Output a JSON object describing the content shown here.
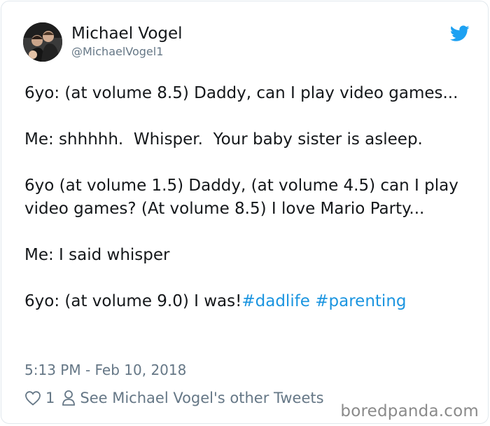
{
  "author": {
    "name": "Michael Vogel",
    "handle": "@MichaelVogel1"
  },
  "tweet": {
    "paragraphs": [
      "6yo: (at volume 8.5) Daddy, can I play video games...",
      "Me: shhhhh.  Whisper.  Your baby sister is asleep.",
      "6yo (at volume 1.5) Daddy, (at volume 4.5) can I play video games? (At volume 8.5) I love Mario Party...",
      "Me: I said whisper"
    ],
    "last_line": "6yo: (at volume 9.0) I was!",
    "hashtags": [
      "#dadlife",
      "#parenting"
    ],
    "timestamp": "5:13 PM - Feb 10, 2018"
  },
  "actions": {
    "like_count": "1",
    "other_tweets_label": "See Michael Vogel's other Tweets"
  },
  "watermark": "boredpanda.com",
  "colors": {
    "link": "#1b95e0",
    "secondary_text": "#657786",
    "twitter_blue": "#1da1f2"
  },
  "icons": [
    "twitter-bird-icon",
    "heart-icon",
    "person-icon"
  ]
}
